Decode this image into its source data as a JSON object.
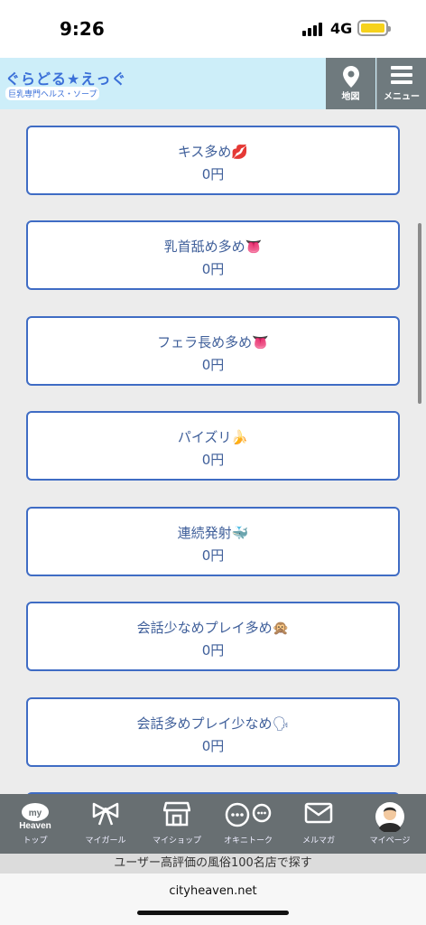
{
  "status": {
    "time": "9:26",
    "network": "4G"
  },
  "header": {
    "logo_main": "ぐらどる★えっぐ",
    "logo_sub": "巨乳専門ヘルス・ソープ",
    "map_label": "地図",
    "menu_label": "メニュー"
  },
  "options": [
    {
      "title": "キス多め💋",
      "price": "0円"
    },
    {
      "title": "乳首舐め多め👅",
      "price": "0円"
    },
    {
      "title": "フェラ長め多め👅",
      "price": "0円"
    },
    {
      "title": "パイズリ🍌",
      "price": "0円"
    },
    {
      "title": "連続発射🐳",
      "price": "0円"
    },
    {
      "title": "会話少なめプレイ多め🙊",
      "price": "0円"
    },
    {
      "title": "会話多めプレイ少なめ🗣",
      "price": "0円"
    }
  ],
  "nav": [
    {
      "label": "トップ",
      "icon": "my-heaven-icon",
      "logo_text": "my Heaven"
    },
    {
      "label": "マイガール",
      "icon": "ribbon-icon"
    },
    {
      "label": "マイショップ",
      "icon": "shop-icon"
    },
    {
      "label": "オキニトーク",
      "icon": "chat-icon"
    },
    {
      "label": "メルマガ",
      "icon": "mail-icon"
    },
    {
      "label": "マイページ",
      "icon": "avatar-icon"
    }
  ],
  "banner": "ユーザー高評価の風俗100名店で探す",
  "browser": {
    "url": "cityheaven.net"
  },
  "colors": {
    "card_border": "#3f6cc4",
    "header_bg": "#cdeef9",
    "nav_bg": "#686f72"
  }
}
